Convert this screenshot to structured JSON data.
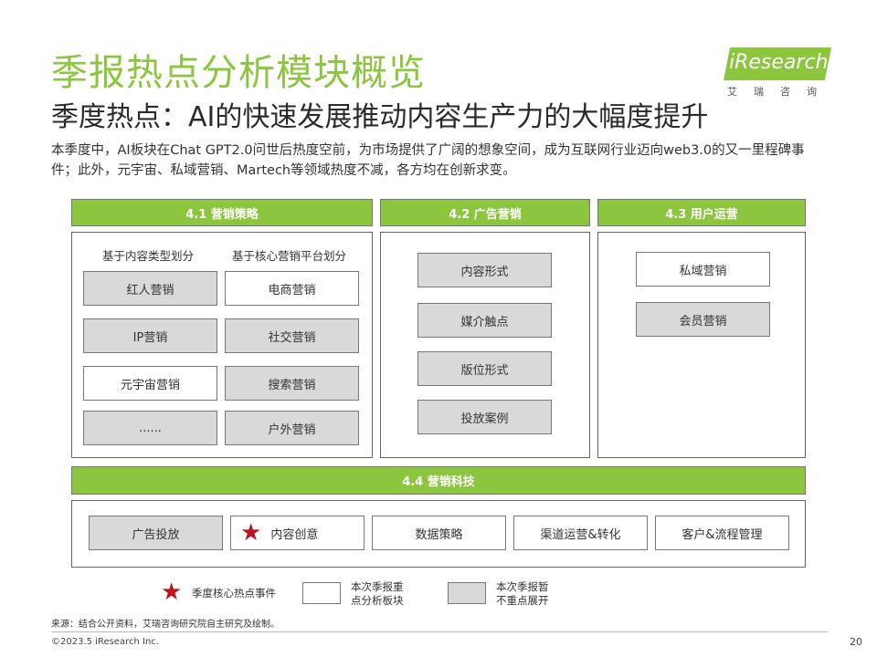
{
  "header": {
    "title": "季报热点分析模块概览",
    "subtitle": "季度热点：AI的快速发展推动内容生产力的大幅度提升",
    "description": "本季度中，AI板块在Chat GPT2.0问世后热度空前，为市场提供了广阔的想象空间，成为互联网行业迈向web3.0的又一里程碑事件；此外，元宇宙、私域营销、Martech等领域热度不减，各方均在创新求变。"
  },
  "logo": {
    "name": "iResearch",
    "sub": "艾瑞咨询"
  },
  "section_41": {
    "title": "4.1 营销策略",
    "col1_header": "基于内容类型划分",
    "col2_header": "基于核心营销平台划分",
    "col1": [
      "红人营销",
      "IP营销",
      "元宇宙营销",
      "......"
    ],
    "col2": [
      "电商营销",
      "社交营销",
      "搜索营销",
      "户外营销"
    ]
  },
  "section_42": {
    "title": "4.2 广告营销",
    "items": [
      "内容形式",
      "媒介触点",
      "版位形式",
      "投放案例"
    ]
  },
  "section_43": {
    "title": "4.3 用户运营",
    "items": [
      "私域营销",
      "会员营销"
    ]
  },
  "section_44": {
    "title": "4.4 营销科技",
    "items": [
      "广告投放",
      "内容创意",
      "数据策略",
      "渠道运营&转化",
      "客户&流程管理"
    ]
  },
  "legend": {
    "star_label": "季度核心热点事件",
    "white_label_l1": "本次季报重",
    "white_label_l2": "点分析板块",
    "gray_label_l1": "本次季报暂",
    "gray_label_l2": "不重点展开"
  },
  "footer": {
    "source": "来源：结合公开资料，艾瑞咨询研究院自主研究及绘制。",
    "copyright": "©2023.5 iResearch Inc.",
    "page": "20"
  },
  "colors": {
    "accent": "#8cc63f",
    "gray_box": "#d9d9d9",
    "star": "#c0131f"
  },
  "icons": {
    "star": "star-icon"
  }
}
